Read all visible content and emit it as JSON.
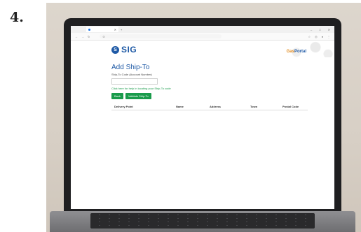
{
  "step": {
    "number": "4."
  },
  "browser": {
    "tab_label": "",
    "url": "",
    "window_controls": [
      "–",
      "□",
      "✕"
    ]
  },
  "header": {
    "logo_text": "SIG",
    "portal_gas": "Gas",
    "portal_portal": "Portal"
  },
  "form": {
    "title": "Add Ship-To",
    "field_label": "Ship-To Code (Account Number)",
    "field_value": "",
    "help_link": "Click here for help in locating your Ship-To code",
    "back_label": "Back",
    "validate_label": "Validate Ship-To"
  },
  "table": {
    "headers": [
      "Delivery Point",
      "Name",
      "Address",
      "Town",
      "Postal Code"
    ]
  },
  "colors": {
    "brand_blue": "#1f5aa6",
    "brand_orange": "#e08a1e",
    "button_green": "#1a9b4b"
  }
}
